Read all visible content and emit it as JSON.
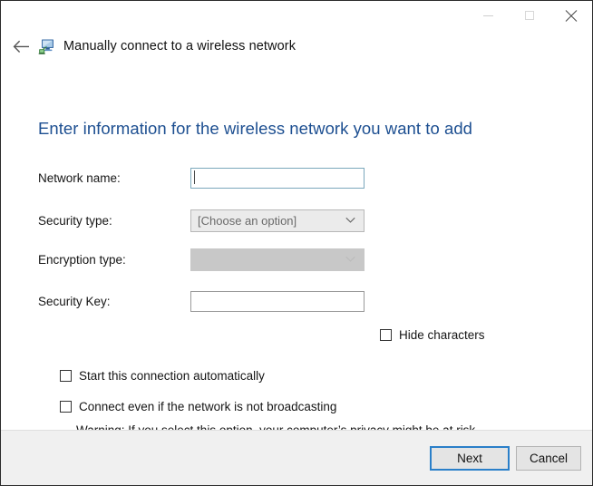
{
  "window": {
    "app_title": "Manually connect to a wireless network",
    "app_icon": "network-computer-icon",
    "back_icon": "back-arrow-icon",
    "controls": {
      "minimize": "minimize-icon",
      "maximize": "maximize-icon",
      "close": "close-icon"
    }
  },
  "page": {
    "heading": "Enter information for the wireless network you want to add",
    "heading_color": "#1d4f91"
  },
  "form": {
    "network_name": {
      "label": "Network name:",
      "value": "",
      "placeholder": "",
      "focused": true
    },
    "security_type": {
      "label": "Security type:",
      "value": "[Choose an option]",
      "enabled": true,
      "options": [
        "[Choose an option]"
      ]
    },
    "encryption_type": {
      "label": "Encryption type:",
      "value": "",
      "enabled": false,
      "options": []
    },
    "security_key": {
      "label": "Security Key:",
      "value": "",
      "placeholder": "",
      "focused": false
    },
    "hide_characters": {
      "label": "Hide characters",
      "checked": false
    }
  },
  "options": {
    "start_automatically": {
      "label": "Start this connection automatically",
      "checked": false
    },
    "connect_not_broadcasting": {
      "label": "Connect even if the network is not broadcasting",
      "checked": false
    },
    "warning": "Warning: If you select this option, your computer’s privacy might be at risk."
  },
  "footer": {
    "next_label": "Next",
    "cancel_label": "Cancel",
    "next_focused": true,
    "accent_color": "#2a7fc9"
  }
}
